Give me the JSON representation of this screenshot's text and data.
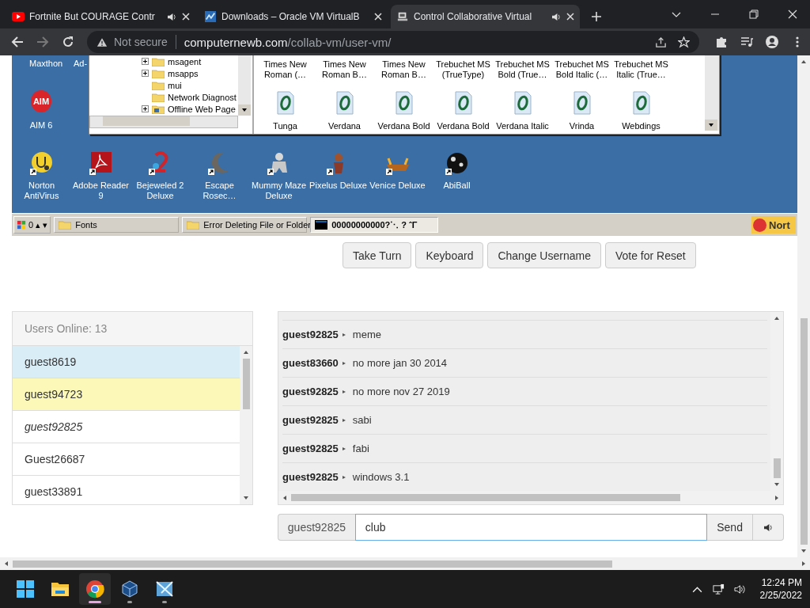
{
  "browser": {
    "tabs": [
      {
        "title": "Fortnite But COURAGE Contr",
        "kind": "video",
        "audio": true,
        "selected": false
      },
      {
        "title": "Downloads – Oracle VM VirtualB",
        "kind": "vbox",
        "audio": false,
        "selected": false
      },
      {
        "title": "Control Collaborative Virtual",
        "kind": "vm",
        "audio": true,
        "selected": true
      }
    ],
    "address": {
      "security": "Not secure",
      "domain": "computernewb.com",
      "path": "/collab-vm/user-vm/"
    }
  },
  "vm": {
    "top_labels": [
      "Maxthon",
      "Ad-"
    ],
    "aim": {
      "label": "AIM 6",
      "badge": "AIM"
    },
    "explorer": {
      "tree": [
        {
          "label": "msagent",
          "expandable": true,
          "kind": "folder"
        },
        {
          "label": "msapps",
          "expandable": true,
          "kind": "folder"
        },
        {
          "label": "mui",
          "expandable": false,
          "kind": "folder"
        },
        {
          "label": "Network Diagnost",
          "expandable": false,
          "kind": "folder"
        },
        {
          "label": "Offline Web Page",
          "expandable": true,
          "kind": "web"
        }
      ],
      "top_fonts": [
        "Times New Roman (…",
        "Times New Roman B…",
        "Times New Roman B…",
        "Trebuchet MS (TrueType)",
        "Trebuchet MS Bold (True…",
        "Trebuchet MS Bold Italic (…",
        "Trebuchet MS Italic (True…"
      ],
      "fonts": [
        "Tunga",
        "Verdana",
        "Verdana Bold",
        "Verdana Bold",
        "Verdana Italic",
        "Vrinda",
        "Webdings"
      ]
    },
    "icons": [
      {
        "label": "Norton AntiVirus",
        "kind": "norton"
      },
      {
        "label": "Adobe Reader 9",
        "kind": "adobe"
      },
      {
        "label": "Bejeweled 2 Deluxe",
        "kind": "gem"
      },
      {
        "label": "Escape Rosec…",
        "kind": "moon"
      },
      {
        "label": "Mummy Maze Deluxe",
        "kind": "mummy"
      },
      {
        "label": "Pixelus Deluxe",
        "kind": "figure"
      },
      {
        "label": "Venice Deluxe",
        "kind": "boat"
      },
      {
        "label": "AbiBall",
        "kind": "ball"
      }
    ],
    "taskbar": {
      "start": "0 ▴ ▾",
      "tasks": [
        {
          "label": "Fonts",
          "kind": "folder",
          "selected": false
        },
        {
          "label": "Error Deleting File or Folder",
          "kind": "folder",
          "selected": false
        },
        {
          "label": "00000000000?⋱ ? ˆΓ",
          "kind": "console",
          "selected": true
        }
      ],
      "tray": "Nort"
    }
  },
  "vm_buttons": [
    "Take Turn",
    "Keyboard",
    "Change Username",
    "Vote for Reset"
  ],
  "users": {
    "title": "Users Online: 13",
    "items": [
      {
        "name": "guest8619",
        "color": "#d9edf7",
        "self": false
      },
      {
        "name": "guest94723",
        "color": "#fcf8b8",
        "self": false
      },
      {
        "name": "guest92825",
        "color": "#ffffff",
        "self": true
      },
      {
        "name": "Guest26687",
        "color": "#ffffff",
        "self": false
      },
      {
        "name": "guest33891",
        "color": "#ffffff",
        "self": false
      }
    ]
  },
  "chat": {
    "messages": [
      {
        "user": "guest92825",
        "text": "meme"
      },
      {
        "user": "guest83660",
        "text": "no more jan 30 2014"
      },
      {
        "user": "guest92825",
        "text": "no more nov 27 2019"
      },
      {
        "user": "guest92825",
        "text": "sabi"
      },
      {
        "user": "guest92825",
        "text": "fabi"
      },
      {
        "user": "guest92825",
        "text": "windows 3.1"
      }
    ],
    "input": {
      "username": "guest92825",
      "value": "club",
      "send": "Send"
    }
  },
  "taskbar": {
    "apps": [
      {
        "kind": "start",
        "selected": false
      },
      {
        "kind": "files",
        "selected": false
      },
      {
        "kind": "chrome",
        "selected": true
      },
      {
        "kind": "vbox",
        "selected": false
      },
      {
        "kind": "vista",
        "selected": false
      }
    ],
    "time": "12:24 PM",
    "date": "2/25/2022"
  }
}
